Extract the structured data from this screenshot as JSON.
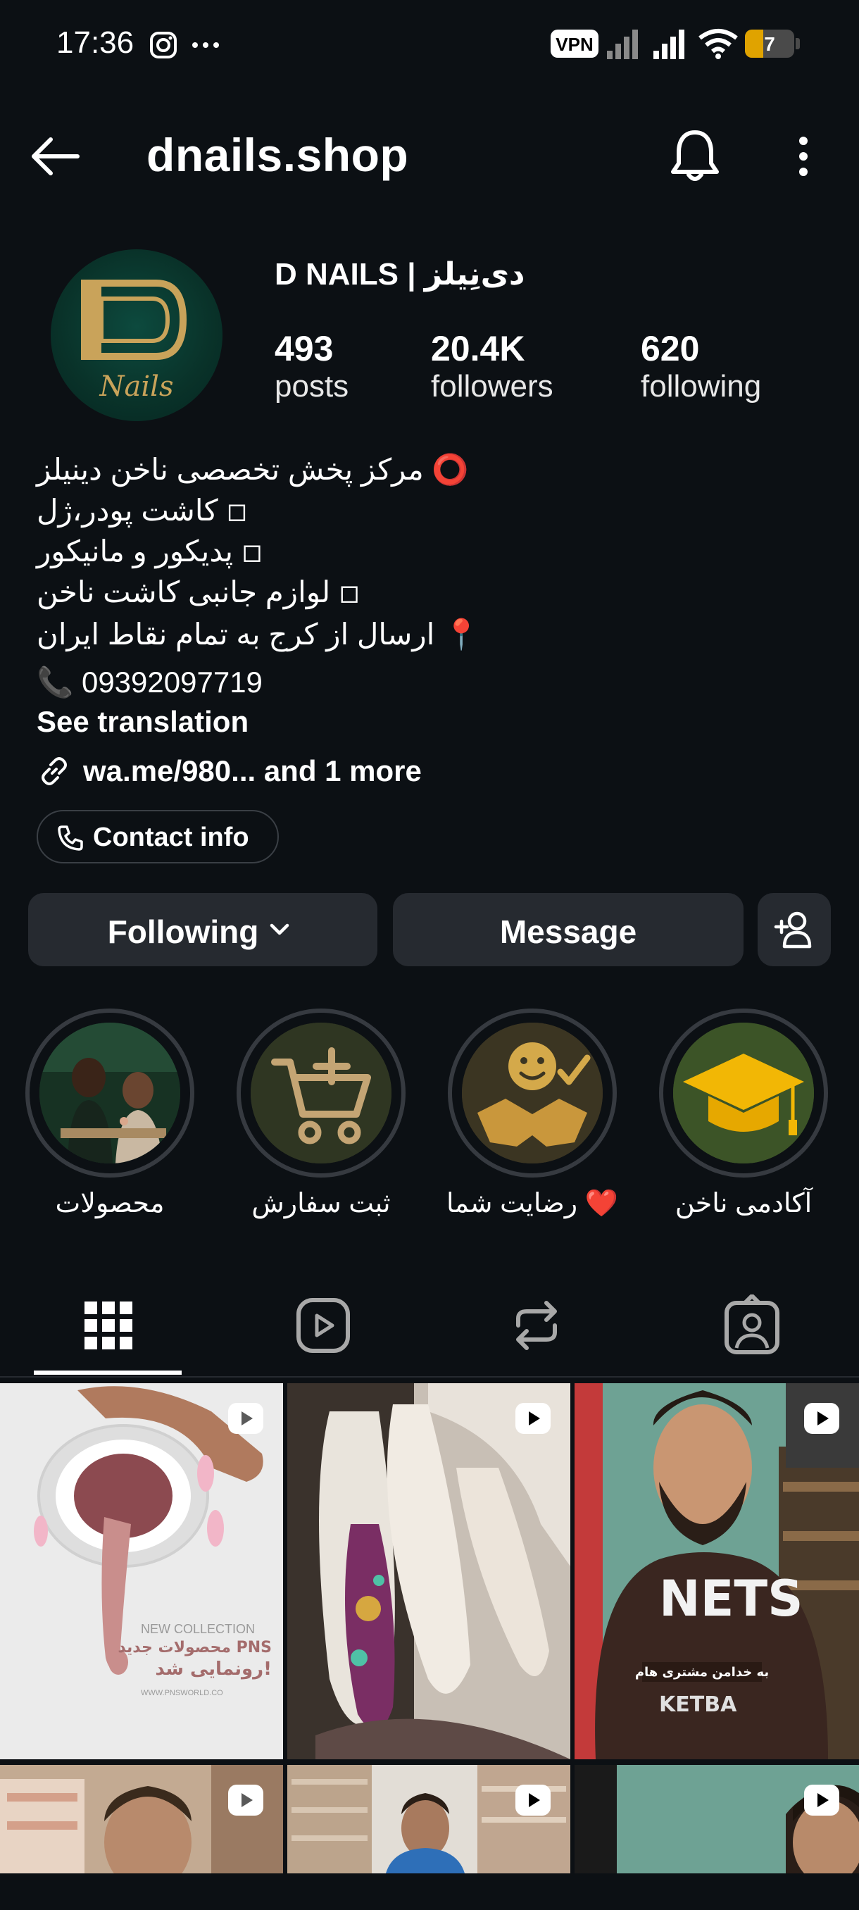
{
  "status_bar": {
    "time": "17:36",
    "vpn_label": "VPN",
    "battery": "7"
  },
  "header": {
    "username": "dnails.shop",
    "back_icon": "arrow-left-icon",
    "bell_icon": "bell-icon",
    "menu_icon": "more-vertical-icon"
  },
  "profile": {
    "display_name": "D NAILS | دی‌نِیلز",
    "avatar_text": "Nails",
    "stats": [
      {
        "value": "493",
        "label": "posts"
      },
      {
        "value": "20.4K",
        "label": "followers"
      },
      {
        "value": "620",
        "label": "following"
      }
    ],
    "bio": [
      "⭕ مرکز پخش تخصصی ناخن دینیلز",
      "◽ کاشت پودر،ژل",
      "◽ پدیکور و مانیکور",
      "◽ لوازم جانبی کاشت ناخن",
      "📍 ارسال از کرج به تمام نقاط ایران",
      "📞 09392097719"
    ],
    "see_translation": "See translation",
    "link": "wa.me/980... and 1 more",
    "contact_info": "Contact info"
  },
  "actions": {
    "following": "Following",
    "message": "Message"
  },
  "highlights": [
    {
      "label": "محصولات"
    },
    {
      "label": "ثبت سفارش"
    },
    {
      "label": "رضایت شما ❤️"
    },
    {
      "label": "آکادمی ناخن"
    }
  ],
  "tabs": [
    "grid-icon",
    "reels-icon",
    "reposts-icon",
    "tagged-icon"
  ],
  "posts": {
    "tile1_caption_1": "NEW COLLECTION",
    "tile1_caption_2": "محصولات جدید PNS",
    "tile1_caption_3": "رونمایی شد!",
    "tile1_caption_4": "WWW.PNSWORLD.CO",
    "tile3_caption": "به خدامن مشتری هام"
  },
  "colors": {
    "background": "#0c1014",
    "button": "#262a30",
    "border": "#3a3f45"
  }
}
